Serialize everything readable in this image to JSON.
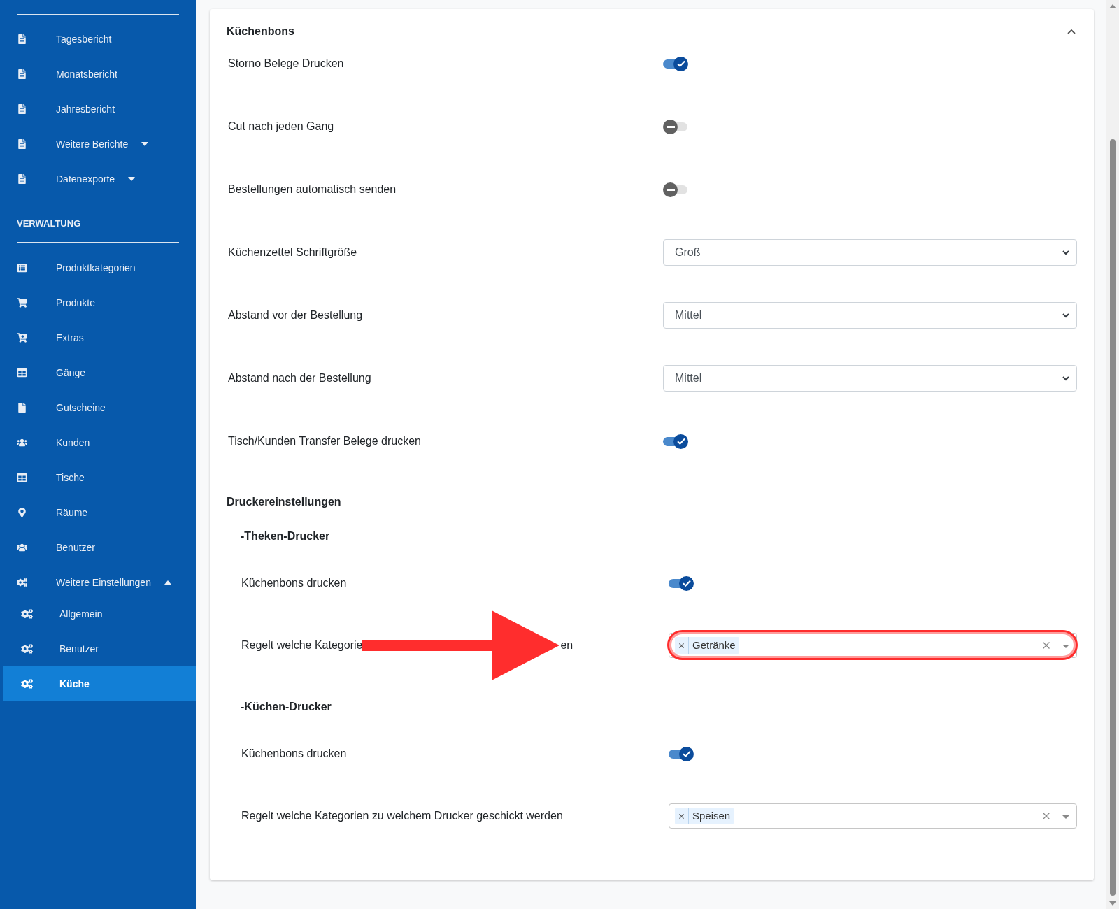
{
  "sidebar": {
    "sections": [
      {
        "items": [
          {
            "kind": "report",
            "label": "Tagesbericht",
            "selected": false,
            "hovered": false
          },
          {
            "kind": "report",
            "label": "Monatsbericht",
            "selected": false,
            "hovered": false
          },
          {
            "kind": "report",
            "label": "Jahresbericht",
            "selected": false,
            "hovered": false
          },
          {
            "kind": "report",
            "label": "Weitere Berichte",
            "selected": false,
            "hovered": false,
            "expanded": false
          },
          {
            "kind": "report",
            "label": "Datenexporte",
            "selected": false,
            "hovered": false,
            "expanded": false
          }
        ]
      },
      {
        "heading": "VERWALTUNG",
        "items": [
          {
            "kind": "list",
            "label": "Produktkategorien",
            "selected": false,
            "hovered": false
          },
          {
            "kind": "cart",
            "label": "Produkte",
            "selected": false,
            "hovered": false
          },
          {
            "kind": "cartplus",
            "label": "Extras",
            "selected": false,
            "hovered": false
          },
          {
            "kind": "grid",
            "label": "Gänge",
            "selected": false,
            "hovered": false
          },
          {
            "kind": "file",
            "label": "Gutscheine",
            "selected": false,
            "hovered": false
          },
          {
            "kind": "people",
            "label": "Kunden",
            "selected": false,
            "hovered": false
          },
          {
            "kind": "grid",
            "label": "Tische",
            "selected": false,
            "hovered": false
          },
          {
            "kind": "pin",
            "label": "Räume",
            "selected": false,
            "hovered": false
          },
          {
            "kind": "people",
            "label": "Benutzer",
            "selected": false,
            "hovered": true
          },
          {
            "kind": "gears",
            "label": "Weitere Einstellungen",
            "selected": false,
            "hovered": false,
            "expanded": true,
            "children": [
              {
                "kind": "gears",
                "label": "Allgemein",
                "selected": false,
                "hovered": false
              },
              {
                "kind": "gears",
                "label": "Benutzer",
                "selected": false,
                "hovered": false
              },
              {
                "kind": "gears",
                "label": "Küche",
                "selected": true,
                "hovered": false
              }
            ]
          }
        ]
      }
    ]
  },
  "panel": {
    "title": "Küchenbons",
    "expanded": true,
    "settings": [
      {
        "kind": "toggle",
        "label": "Storno Belege Drucken",
        "on": true
      },
      {
        "kind": "toggle",
        "label": "Cut nach jeden Gang",
        "on": false
      },
      {
        "kind": "toggle",
        "label": "Bestellungen automatisch senden",
        "on": false
      },
      {
        "kind": "select",
        "label": "Küchenzettel Schriftgröße",
        "value": "Groß"
      },
      {
        "kind": "select",
        "label": "Abstand vor der Bestellung",
        "value": "Mittel"
      },
      {
        "kind": "select",
        "label": "Abstand nach der Bestellung",
        "value": "Mittel"
      },
      {
        "kind": "toggle",
        "label": "Tisch/Kunden Transfer Belege drucken",
        "on": true
      }
    ],
    "printer_settings": {
      "title": "Druckereinstellungen",
      "printers": [
        {
          "title": "-Theken-Drucker",
          "print_toggle": {
            "label": "Küchenbons drucken",
            "on": true
          },
          "categories": {
            "label_parts": [
              "Regelt welche Kategorie",
              "en"
            ],
            "arrow_annotation": true,
            "highlighted": true,
            "tags": [
              "Getränke"
            ]
          }
        },
        {
          "title": "-Küchen-Drucker",
          "print_toggle": {
            "label": "Küchenbons drucken",
            "on": true
          },
          "categories": {
            "label_parts": [
              "Regelt welche Kategorien zu welchem Drucker geschickt werden"
            ],
            "arrow_annotation": false,
            "highlighted": false,
            "tags": [
              "Speisen"
            ]
          }
        }
      ]
    }
  }
}
